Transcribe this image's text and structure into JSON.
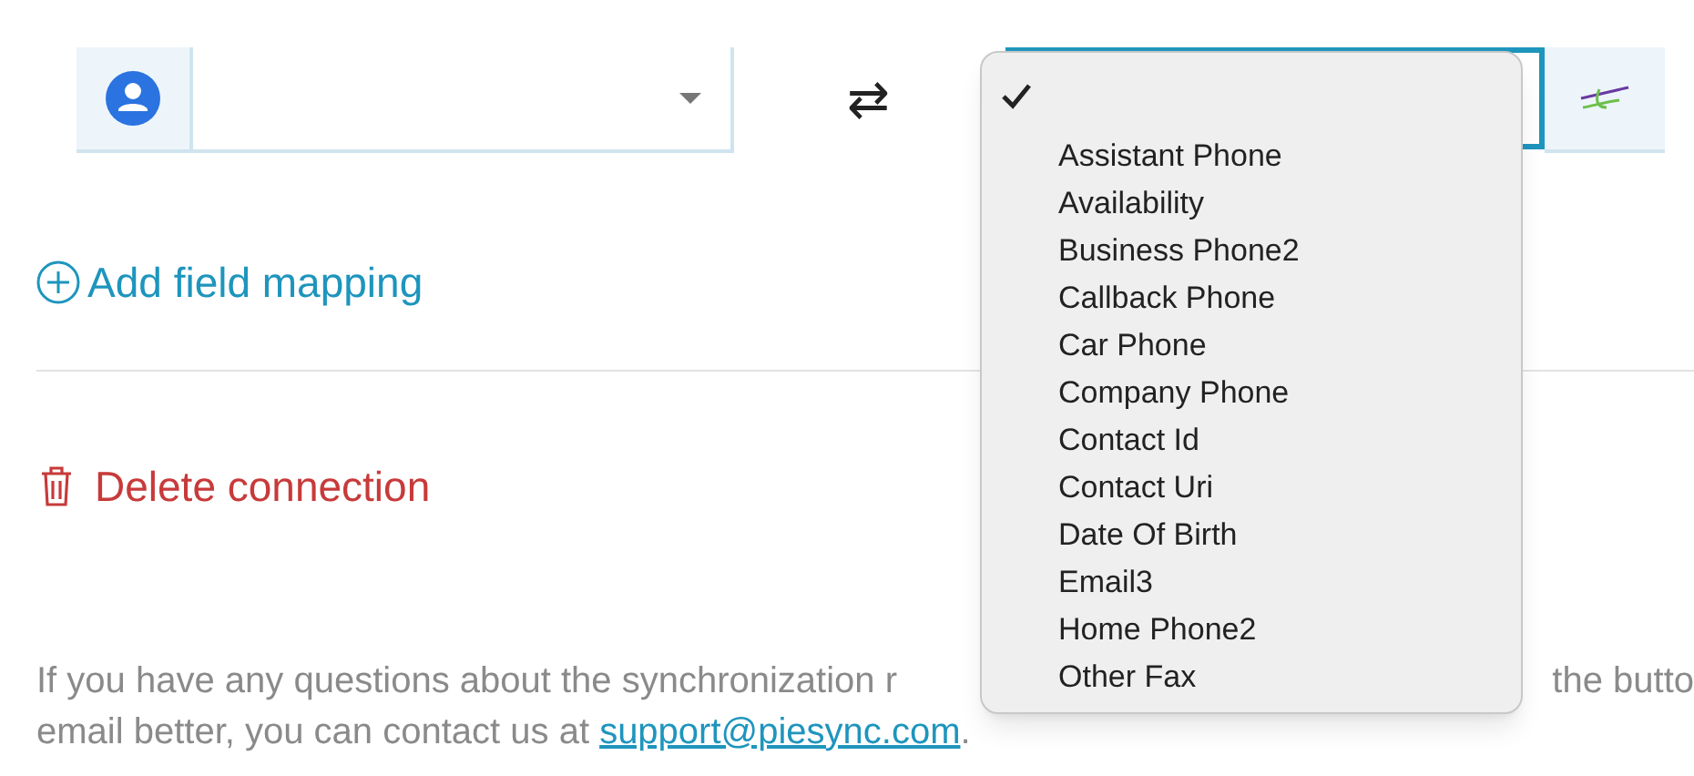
{
  "mapping": {
    "swap": "⇄"
  },
  "add_mapping": "Add field mapping",
  "delete": "Delete connection",
  "help": {
    "line1_left": "If you have any questions about the synchronization r",
    "line1_right": "the butto",
    "line2": "email better, you can contact us at ",
    "link": "support@piesync.com",
    "end": "."
  },
  "menu": {
    "items": [
      {
        "selected": true
      },
      {
        "label": "Assistant Phone",
        "selected": false
      },
      {
        "label": "Availability",
        "selected": false
      },
      {
        "label": "Business Phone2",
        "selected": false
      },
      {
        "label": "Callback Phone",
        "selected": false
      },
      {
        "label": "Car Phone",
        "selected": false
      },
      {
        "label": "Company Phone",
        "selected": false
      },
      {
        "label": "Contact Id",
        "selected": false
      },
      {
        "label": "Contact Uri",
        "selected": false
      },
      {
        "label": "Date Of Birth",
        "selected": false
      },
      {
        "label": "Email3",
        "selected": false
      },
      {
        "label": "Home Phone2",
        "selected": false
      },
      {
        "label": "Other Fax",
        "selected": false
      }
    ]
  }
}
